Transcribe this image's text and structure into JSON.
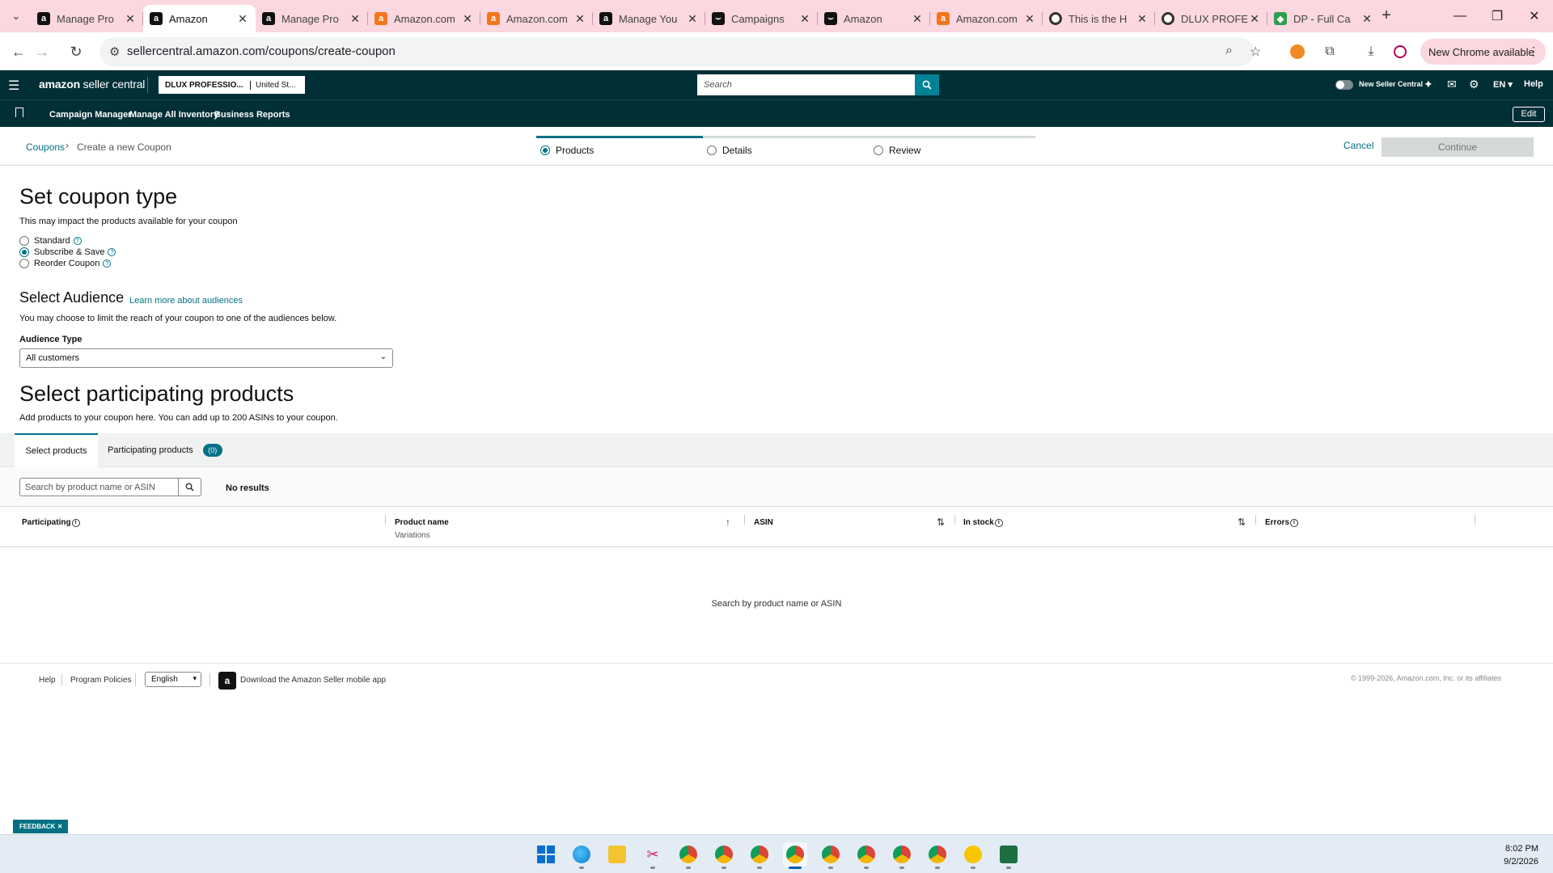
{
  "browser": {
    "tabs": [
      {
        "title": "Manage Pro",
        "favicon": "amazon-a",
        "active": false
      },
      {
        "title": "Amazon",
        "favicon": "amazon-a",
        "active": true
      },
      {
        "title": "Manage Pro",
        "favicon": "amazon-a",
        "active": false
      },
      {
        "title": "Amazon.com",
        "favicon": "amazon-orange",
        "active": false
      },
      {
        "title": "Amazon.com",
        "favicon": "amazon-orange",
        "active": false
      },
      {
        "title": "Manage You",
        "favicon": "amazon-a",
        "active": false
      },
      {
        "title": "Campaigns",
        "favicon": "amazon-ads",
        "active": false
      },
      {
        "title": "Amazon",
        "favicon": "amazon-ads",
        "active": false
      },
      {
        "title": "Amazon.com",
        "favicon": "amazon-orange",
        "active": false
      },
      {
        "title": "This is the H",
        "favicon": "globe",
        "active": false
      },
      {
        "title": "DLUX PROFE",
        "favicon": "globe",
        "active": false
      },
      {
        "title": "DP - Full Ca",
        "favicon": "green-tag",
        "active": false
      }
    ],
    "url": "sellercentral.amazon.com/coupons/create-coupon",
    "chrome_update": "New Chrome available"
  },
  "header": {
    "logo_main": "amazon",
    "logo_sub": " seller central",
    "account_name": "DLUX PROFESSIO...",
    "marketplace": "United St...",
    "search_placeholder": "Search",
    "new_seller_central": "New Seller Central",
    "language": "EN",
    "help": "Help"
  },
  "nav": {
    "links": [
      "Campaign Manager",
      "Manage All Inventory",
      "Business Reports"
    ],
    "edit": "Edit"
  },
  "breadcrumb": {
    "root": "Coupons",
    "current": "Create a new Coupon"
  },
  "steps": [
    {
      "label": "Products",
      "active": true
    },
    {
      "label": "Details",
      "active": false
    },
    {
      "label": "Review",
      "active": false
    }
  ],
  "actions": {
    "cancel": "Cancel",
    "continue": "Continue"
  },
  "coupon_type": {
    "title": "Set coupon type",
    "subtitle": "This may impact the products available for your coupon",
    "options": [
      {
        "label": "Standard",
        "selected": false
      },
      {
        "label": "Subscribe & Save",
        "selected": true
      },
      {
        "label": "Reorder Coupon",
        "selected": false
      }
    ]
  },
  "audience": {
    "title": "Select Audience",
    "learn_more": "Learn more about audiences",
    "subtitle": "You may choose to limit the reach of your coupon to one of the audiences below.",
    "type_label": "Audience Type",
    "type_value": "All customers"
  },
  "products": {
    "title": "Select participating products",
    "subtitle": "Add products to your coupon here. You can add up to 200 ASINs to your coupon.",
    "tab_select": "Select products",
    "tab_participating": "Participating products",
    "participating_count": "(0)",
    "search_placeholder": "Search by product name or ASIN",
    "no_results": "No results",
    "columns": {
      "participating": "Participating",
      "product_name": "Product name",
      "variations": "Variations",
      "asin": "ASIN",
      "in_stock": "In stock",
      "errors": "Errors"
    },
    "empty_message": "Search by product name or ASIN"
  },
  "footer": {
    "help": "Help",
    "program_policies": "Program Policies",
    "language": "English",
    "app_link": "Download the Amazon Seller mobile app",
    "copyright": "© 1999-2026, Amazon.com, Inc. or its affiliates"
  },
  "feedback": "FEEDBACK",
  "taskbar": {
    "time": "8:02 PM",
    "date": "9/2/2026"
  },
  "colors": {
    "header_bg": "#002f36",
    "link": "#007185",
    "tabbar": "#fbd7df"
  }
}
